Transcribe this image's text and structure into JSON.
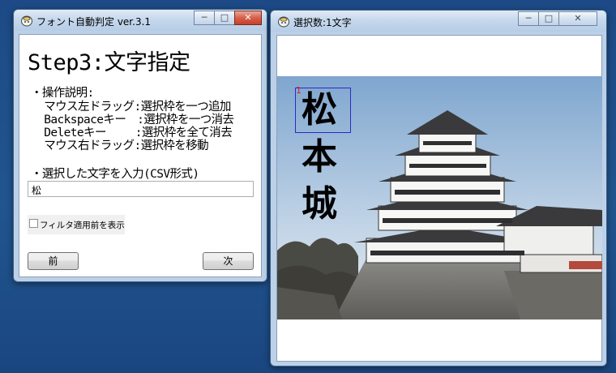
{
  "left_window": {
    "title": "フォント自動判定 ver.3.1",
    "step_title": "Step3:文字指定",
    "instructions": [
      "・操作説明:",
      "  マウス左ドラッグ:選択枠を一つ追加",
      "  Backspaceキー　:選択枠を一つ消去",
      "  Deleteキー　　 :選択枠を全て消去",
      "  マウス右ドラッグ:選択枠を移動"
    ],
    "input_prompt": "・選択した文字を入力(CSV形式)",
    "input_value": "松",
    "checkbox_label": "フィルタ適用前を表示",
    "prev_label": "前",
    "next_label": "次"
  },
  "right_window": {
    "title": "選択数:1文字",
    "selection_number": "1",
    "sign_chars": [
      "松",
      "本",
      "城"
    ]
  },
  "caption_buttons": {
    "minimize": "─",
    "maximize": "□",
    "close": "✕"
  },
  "colors": {
    "desktop": "#1f4f8c",
    "selection_box": "#2a2ac8",
    "selection_number": "#e02020"
  }
}
